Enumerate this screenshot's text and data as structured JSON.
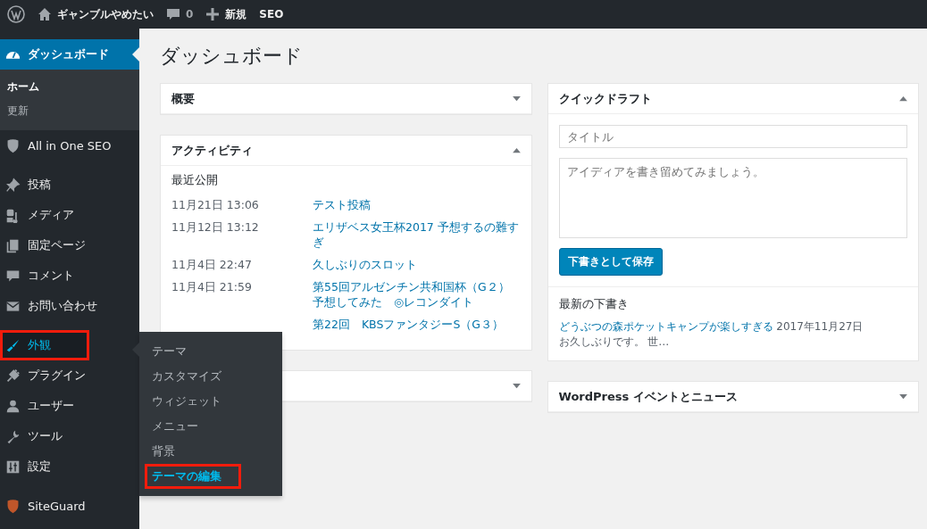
{
  "admin_bar": {
    "site_name": "ギャンブルやめたい",
    "comments_count": "0",
    "new_label": "新規",
    "seo_label": "SEO"
  },
  "sidebar": {
    "groups": [
      [
        {
          "label": "ダッシュボード",
          "current": true,
          "highlighted": false,
          "submenu": [
            {
              "label": "ホーム",
              "selected": true
            },
            {
              "label": "更新",
              "selected": false
            }
          ]
        },
        {
          "label": "All in One SEO",
          "current": false,
          "highlighted": false
        }
      ],
      [
        {
          "label": "投稿",
          "current": false,
          "highlighted": false
        },
        {
          "label": "メディア",
          "current": false,
          "highlighted": false
        },
        {
          "label": "固定ページ",
          "current": false,
          "highlighted": false
        },
        {
          "label": "コメント",
          "current": false,
          "highlighted": false
        },
        {
          "label": "お問い合わせ",
          "current": false,
          "highlighted": false
        }
      ],
      [
        {
          "label": "外観",
          "current": false,
          "hovered": true,
          "highlighted": true
        },
        {
          "label": "プラグイン",
          "current": false,
          "highlighted": false
        },
        {
          "label": "ユーザー",
          "current": false,
          "highlighted": false
        },
        {
          "label": "ツール",
          "current": false,
          "highlighted": false
        },
        {
          "label": "設定",
          "current": false,
          "highlighted": false
        }
      ],
      [
        {
          "label": "SiteGuard",
          "current": false,
          "highlighted": false
        }
      ]
    ]
  },
  "flyout": [
    {
      "label": "テーマ",
      "selected": false,
      "highlighted": false
    },
    {
      "label": "カスタマイズ",
      "selected": false,
      "highlighted": false
    },
    {
      "label": "ウィジェット",
      "selected": false,
      "highlighted": false
    },
    {
      "label": "メニュー",
      "selected": false,
      "highlighted": false
    },
    {
      "label": "背景",
      "selected": false,
      "highlighted": false
    },
    {
      "label": "テーマの編集",
      "selected": true,
      "highlighted": true
    }
  ],
  "page_title": "ダッシュボード",
  "left_panels": [
    {
      "title": "概要",
      "expanded": false
    },
    {
      "title": "アクティビティ",
      "expanded": true,
      "activity": {
        "heading": "最近公開",
        "items": [
          {
            "date": "11月21日 13:06",
            "title": "テスト投稿"
          },
          {
            "date": "11月12日 13:12",
            "title": "エリザベス女王杯2017 予想するの難すぎ"
          },
          {
            "date": "11月4日 22:47",
            "title": "久しぶりのスロット"
          },
          {
            "date": "11月4日 21:59",
            "title": "第55回アルゼンチン共和国杯（G２）予想してみた　◎レコンダイト"
          },
          {
            "title": "第22回　KBSファンタジーS（G３）"
          }
        ]
      }
    },
    {
      "expanded": false
    }
  ],
  "right_panels": [
    {
      "title": "クイックドラフト",
      "expanded": true,
      "quick_draft": {
        "title_placeholder": "タイトル",
        "content_placeholder": "アイディアを書き留めてみましょう。",
        "save_button": "下書きとして保存",
        "drafts_heading": "最新の下書き",
        "drafts": [
          {
            "title": "どうぶつの森ポケットキャンプが楽しすぎる",
            "date": "2017年11月27日",
            "excerpt": "お久しぶりです。 世…"
          }
        ]
      }
    },
    {
      "title": "WordPress イベントとニュース",
      "expanded": false
    }
  ]
}
